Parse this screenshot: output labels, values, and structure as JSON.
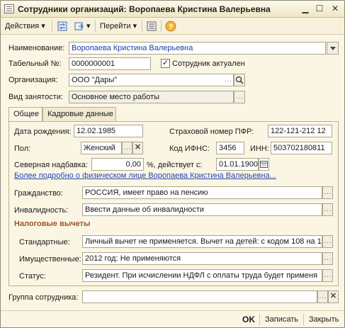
{
  "window": {
    "title": "Сотрудники организаций: Воропаева Кристина Валерьевна"
  },
  "toolbar": {
    "actions_label": "Действия",
    "goto_label": "Перейти"
  },
  "fields": {
    "name_label": "Наименование:",
    "name_value": "Воропаева Кристина Валерьевна",
    "tab_no_label": "Табельный №:",
    "tab_no_value": "0000000001",
    "active_label": "Сотрудник актуален",
    "active_checked": "✓",
    "org_label": "Организация:",
    "org_value": "ООО \"Дары\"",
    "employment_label": "Вид занятости:",
    "employment_value": "Основное место работы"
  },
  "tabs": {
    "general": "Общее",
    "hr": "Кадровые данные"
  },
  "general": {
    "birth_label": "Дата рождения:",
    "birth_value": "12.02.1985",
    "pfr_label": "Страховой номер ПФР:",
    "pfr_value": "122-121-212 12",
    "sex_label": "Пол:",
    "sex_value": "Женский",
    "ifns_label": "Код ИФНС:",
    "ifns_value": "3456",
    "inn_label": "ИНН:",
    "inn_value": "503702180811",
    "north_label": "Северная надбавка:",
    "north_value": "0,00",
    "north_unit": "%, действует с:",
    "north_date": "01.01.1900",
    "more_link": "Более подробно о физическом лице Воропаева Кристина Валерьевна...",
    "citizenship_label": "Гражданство:",
    "citizenship_value": "РОССИЯ, имеет право на пенсию",
    "disability_label": "Инвалидность:",
    "disability_value": "Ввести данные об инвалидности",
    "tax_section": "Налоговые вычеты",
    "standard_label": "Стандартные:",
    "standard_value": "Личный вычет не применяется. Вычет на детей: с кодом 108 на 1",
    "property_label": "Имущественные:",
    "property_value": "2012 год: Не применяются",
    "status_label": "Статус:",
    "status_value": "Резидент. При исчислении НДФЛ с оплаты труда будет применя"
  },
  "group": {
    "label": "Группа сотрудника:",
    "value": ""
  },
  "footer": {
    "ok": "OK",
    "save": "Записать",
    "close": "Закрыть"
  }
}
